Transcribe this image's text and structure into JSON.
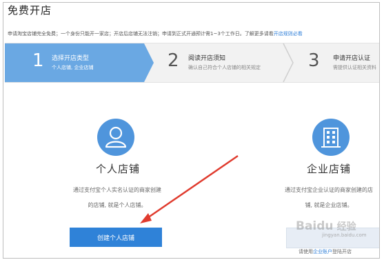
{
  "page": {
    "title": "免费开店",
    "notice_text": "申请淘宝店铺完全免费；一个身份只能开一家店；开店后店铺无法注销；申请到正式开通预计需1~3个工作日。了解更多请看",
    "notice_link": "开店规则必看"
  },
  "steps": [
    {
      "num": "1",
      "title": "选择开店类型",
      "subtitle": "个人店铺, 企业店铺",
      "active": true
    },
    {
      "num": "2",
      "title": "阅读开店须知",
      "subtitle": "确认自己符合个人店铺的相关规定",
      "active": false
    },
    {
      "num": "3",
      "title": "申请开店认证",
      "subtitle": "需提供认证相关资料",
      "active": false
    }
  ],
  "personal": {
    "icon": "user-icon",
    "title": "个人店铺",
    "desc_line1": "通过支付宝个人实名认证的商家创建",
    "desc_line2": "的店铺, 就是个人店铺。",
    "button_label": "创建个人店铺"
  },
  "enterprise": {
    "icon": "building-icon",
    "title": "企业店铺",
    "desc_line1": "通过支付宝企业认证的商家创建的店",
    "desc_line2": "铺, 就是企业店铺。",
    "note_prefix": "请使用",
    "note_link": "企业账户",
    "note_suffix": "登陆开店"
  },
  "watermark": {
    "brand": "Baidu",
    "cn": "经验",
    "url": "jingyan.baidu.com"
  },
  "colors": {
    "accent": "#2f82d8",
    "step_active": "#6aa8e3",
    "icon_circle": "#4f95dc",
    "arrow": "#e03b2e"
  }
}
